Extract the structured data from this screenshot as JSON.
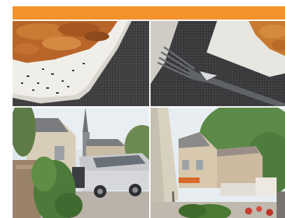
{
  "header": {
    "accent_color": "#F5922B"
  },
  "gallery": {
    "photos": [
      {
        "subject": "plate-of-fried-potatoes"
      },
      {
        "subject": "fork-on-placemat"
      },
      {
        "subject": "street-with-parked-car"
      },
      {
        "subject": "town-square-with-umbrella"
      }
    ]
  }
}
